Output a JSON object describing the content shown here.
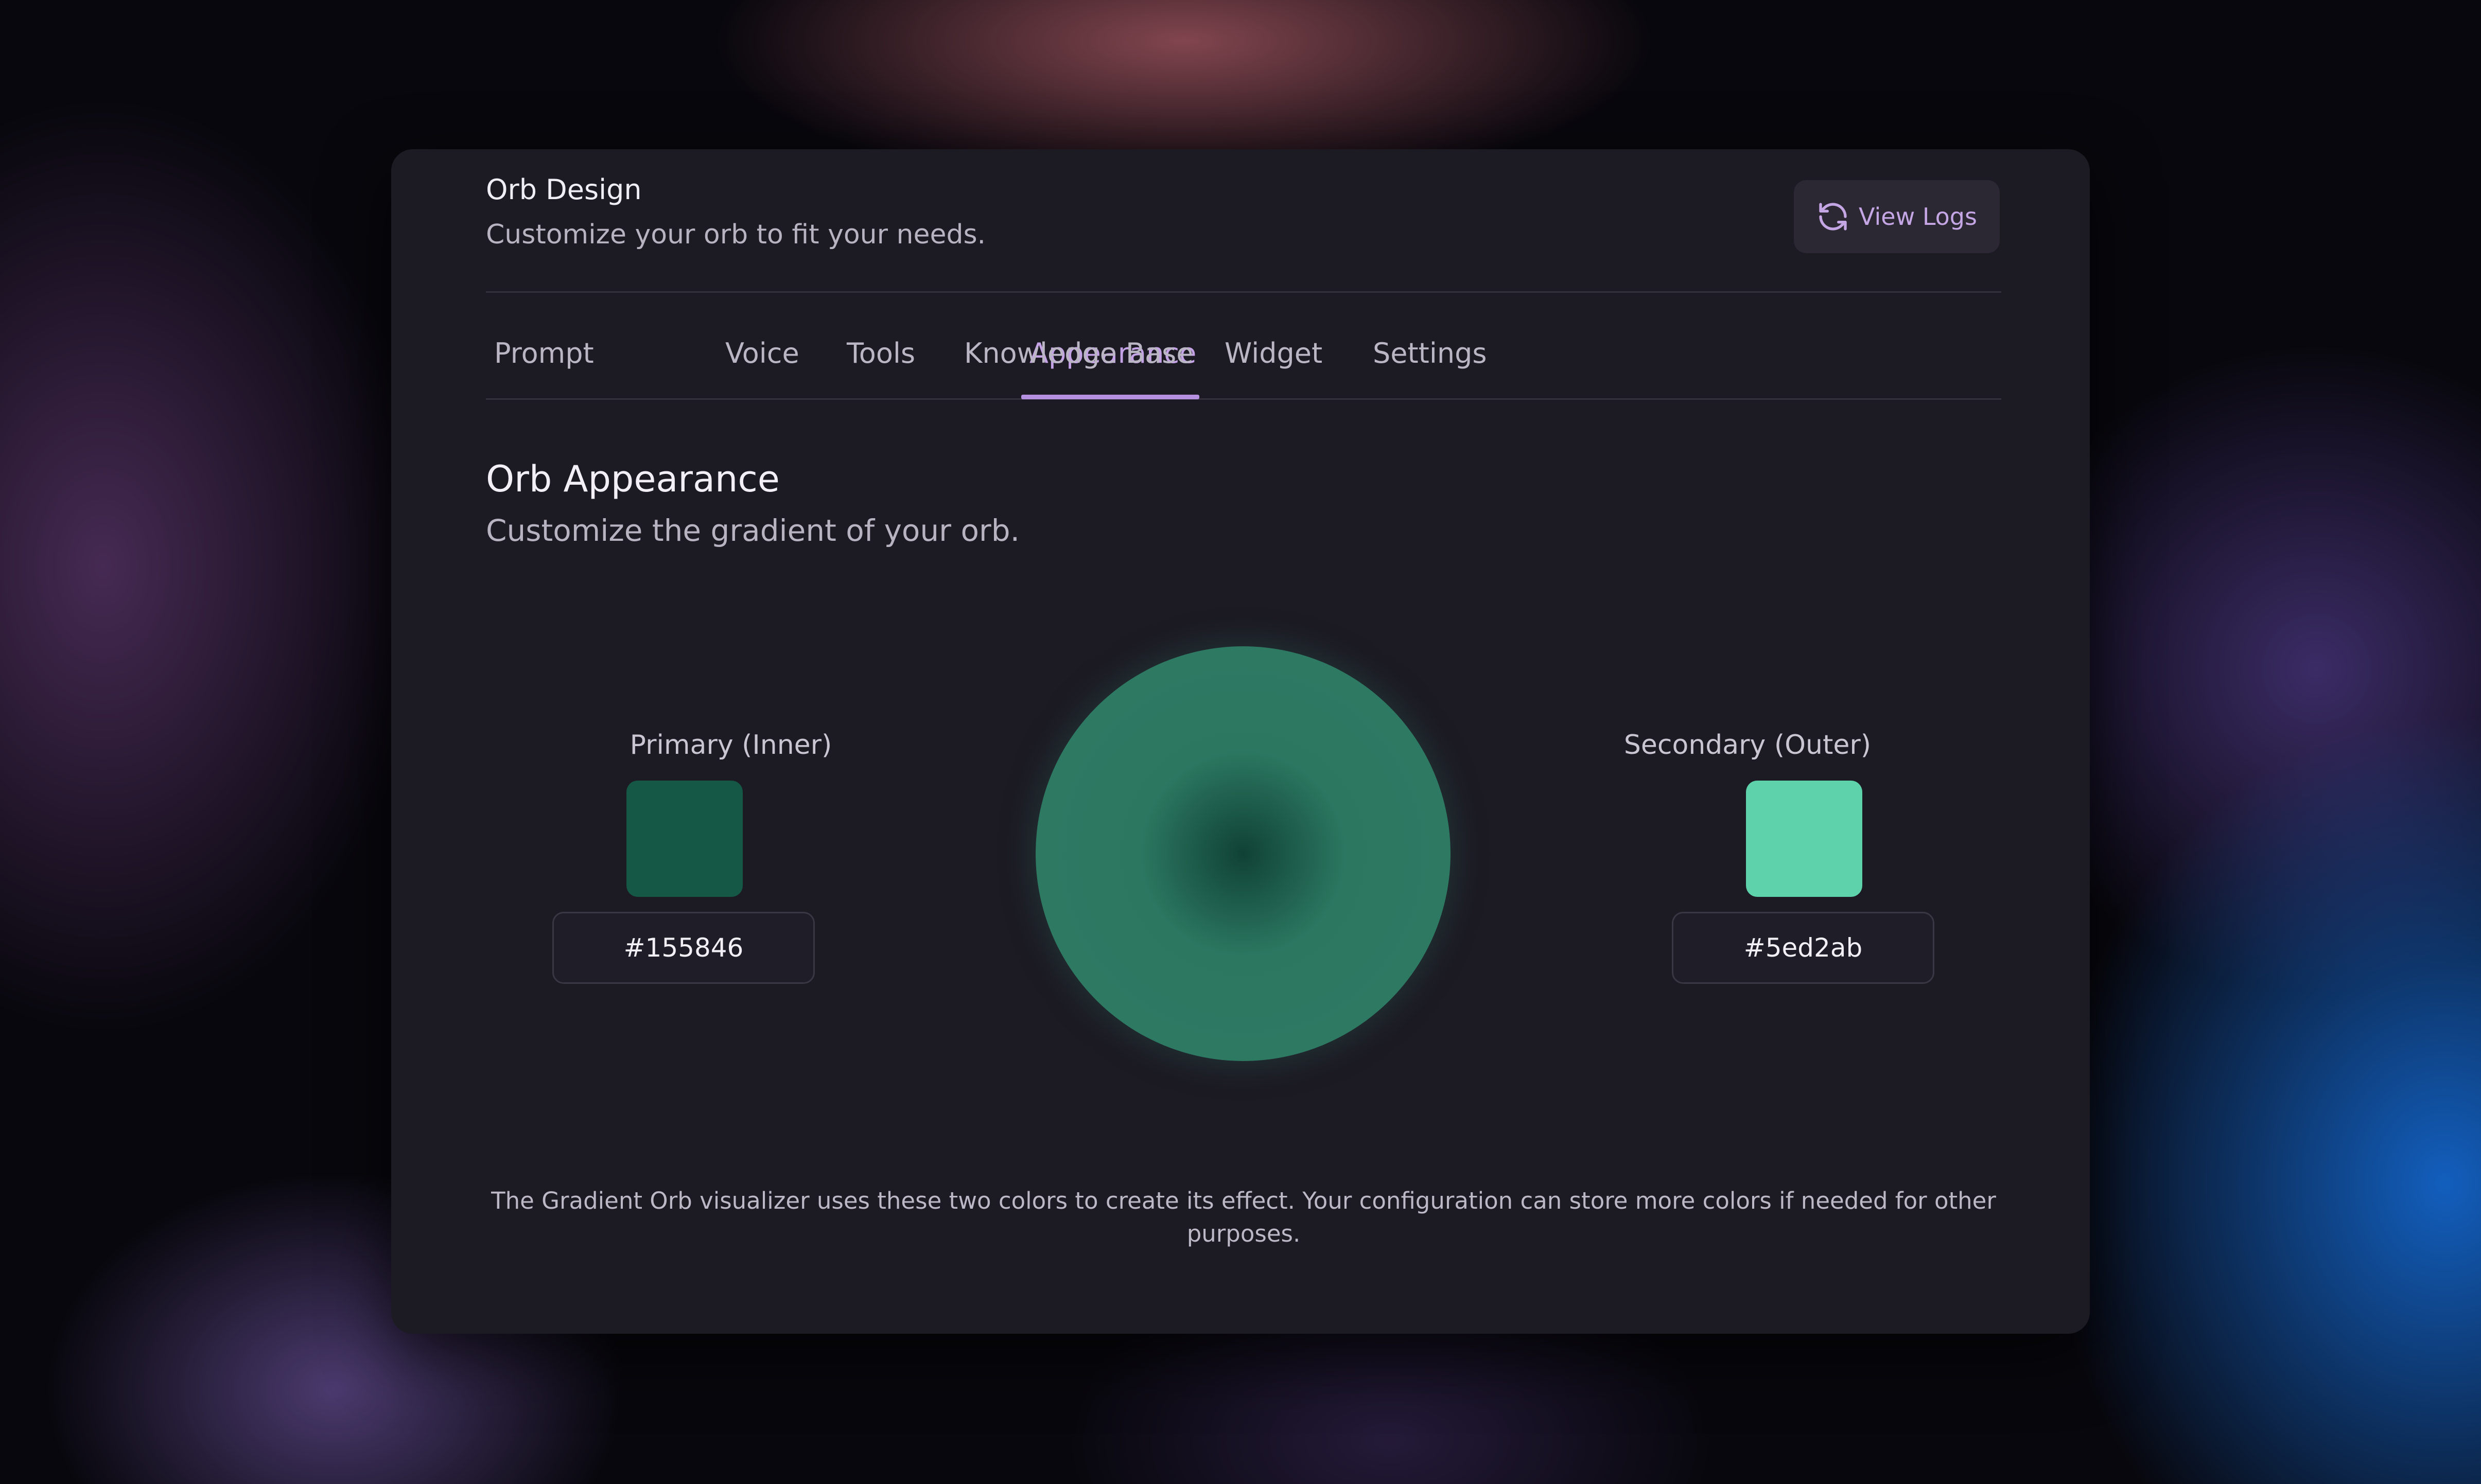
{
  "header": {
    "title": "Orb Design",
    "subtitle": "Customize your orb to fit your needs.",
    "view_logs_label": "View Logs",
    "view_logs_icon": "refresh-icon"
  },
  "tabs": [
    {
      "label": "Prompt",
      "active": false
    },
    {
      "label": "Appearance",
      "active": true
    },
    {
      "label": "Voice",
      "active": false
    },
    {
      "label": "Tools",
      "active": false
    },
    {
      "label": "Knowledge Base",
      "active": false
    },
    {
      "label": "Widget",
      "active": false
    },
    {
      "label": "Settings",
      "active": false
    }
  ],
  "section": {
    "title": "Orb Appearance",
    "subtitle": "Customize the gradient of your orb."
  },
  "primary": {
    "label": "Primary (Inner)",
    "hex": "#155846",
    "swatch_color": "#155846"
  },
  "secondary": {
    "label": "Secondary (Outer)",
    "hex": "#5ed2ab",
    "swatch_color": "#5ed2ab"
  },
  "footer": {
    "note": "The Gradient Orb visualizer uses these two colors to create its effect. Your configuration can store more colors if needed for other purposes."
  },
  "colors": {
    "accent": "#c4a2e6",
    "card_background": "#1c1a23"
  }
}
